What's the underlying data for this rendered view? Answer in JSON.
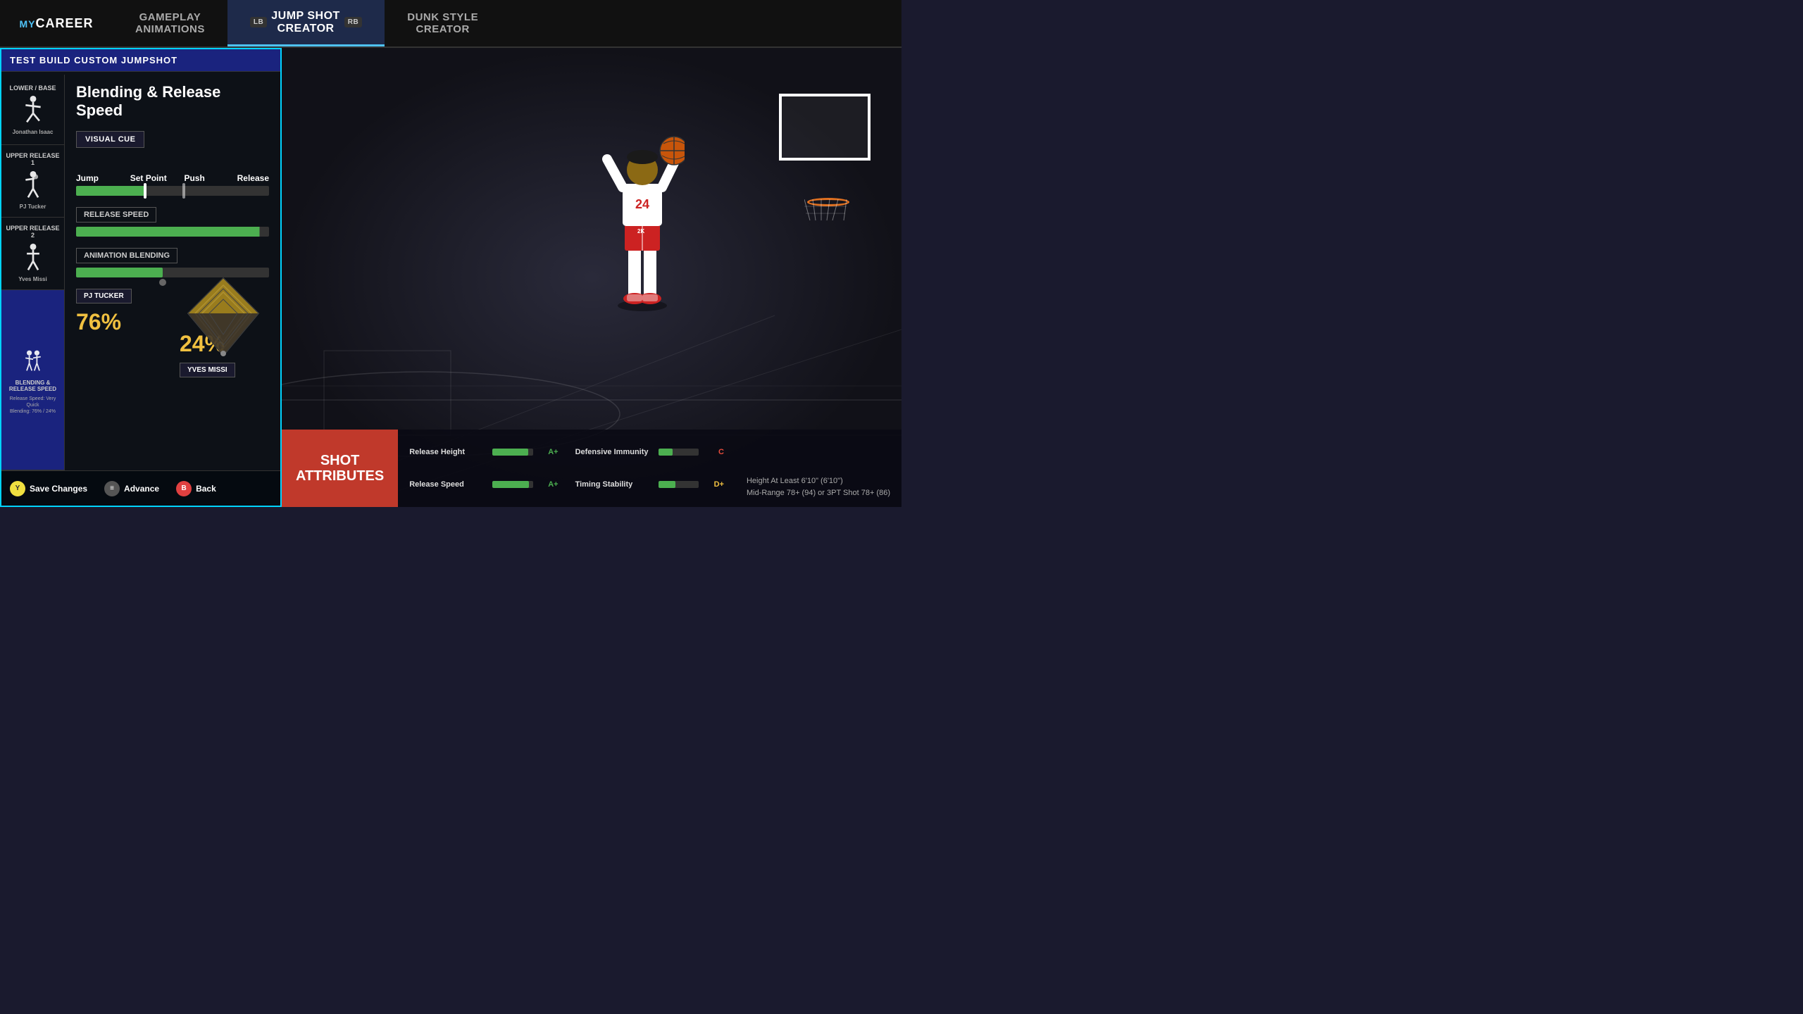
{
  "nav": {
    "logo": "myCAREER",
    "logo_prefix": "my",
    "tabs": [
      {
        "id": "gameplay",
        "label": "Gameplay\nAnimations",
        "active": false
      },
      {
        "id": "jumpshot",
        "label": "Jump Shot Creator",
        "active": true,
        "lb": "LB",
        "rb": "RB"
      },
      {
        "id": "dunk",
        "label": "Dunk Style Creator",
        "active": false
      }
    ]
  },
  "panel": {
    "title": "TEST BUILD CUSTOM JUMPSHOT",
    "sidebar": {
      "sections": [
        {
          "id": "lower-base",
          "label": "Lower / Base",
          "player": "Jonathan Isaac",
          "active": false
        },
        {
          "id": "upper-release-1",
          "label": "Upper Release 1",
          "player": "PJ Tucker",
          "active": false
        },
        {
          "id": "upper-release-2",
          "label": "Upper Release 2",
          "player": "Yves Missi",
          "active": false
        },
        {
          "id": "blending",
          "label": "Blending & Release Speed",
          "sublabel": "Release Speed: Very Quick\nBlending: 76% / 24%",
          "active": true
        }
      ]
    },
    "content": {
      "title": "Blending & Release Speed",
      "visual_cue_label": "VISUAL CUE",
      "slider_jump_label": "Jump",
      "slider_set_point_label": "Set Point",
      "slider_push_label": "Push",
      "slider_release_label": "Release",
      "release_speed_label": "RELEASE SPEED",
      "animation_blending_label": "ANIMATION BLENDING",
      "player1_badge": "PJ TUCKER",
      "player1_pct": "76%",
      "player2_badge": "YVES MISSI",
      "player2_pct": "24%",
      "release_speed_fill": 95,
      "blend_fill": 45
    },
    "bottom_actions": [
      {
        "btn": "Y",
        "label": "Save Changes",
        "type": "y"
      },
      {
        "btn": "≡",
        "label": "Advance",
        "type": "menu"
      },
      {
        "btn": "B",
        "label": "Back",
        "type": "b"
      }
    ]
  },
  "shot_attributes": {
    "label": "SHOT\nATTRIBUTES",
    "rows": [
      {
        "name": "Release Height",
        "fill": 88,
        "grade": "A+",
        "grade_color": "green"
      },
      {
        "name": "Defensive Immunity",
        "fill": 35,
        "grade": "C",
        "grade_color": "red"
      },
      {
        "name": "Release Speed",
        "fill": 90,
        "grade": "A+",
        "grade_color": "green"
      },
      {
        "name": "Timing Stability",
        "fill": 40,
        "grade": "D+",
        "grade_color": "yellow"
      }
    ],
    "footer_line1": "Height At Least 6'10\" (6'10\")",
    "footer_line2": "Mid-Range 78+ (94) or 3PT Shot 78+ (86)"
  }
}
